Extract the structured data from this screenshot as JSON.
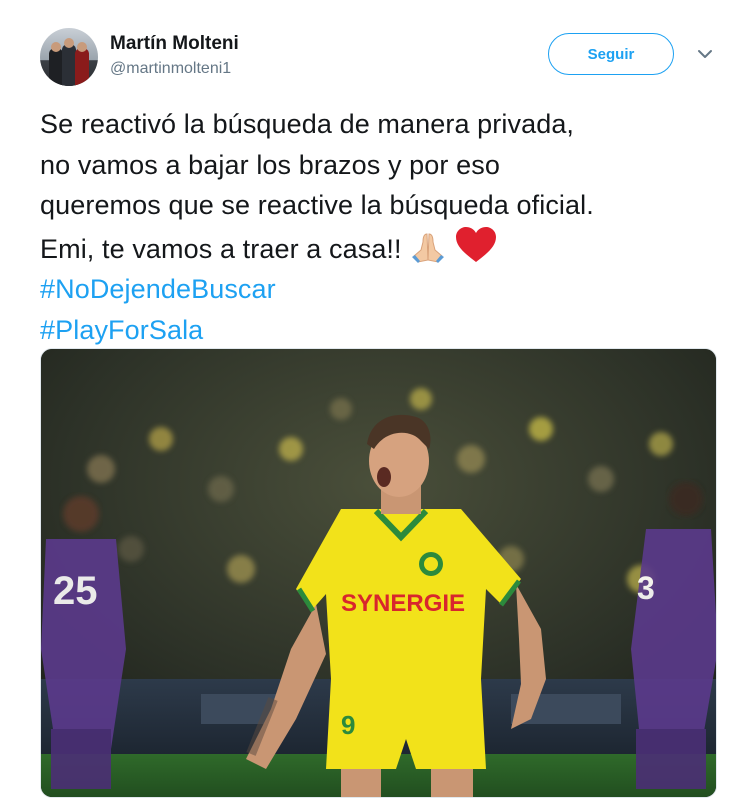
{
  "user": {
    "display_name": "Martín Molteni",
    "handle": "@martinmolteni1"
  },
  "follow_button": {
    "label": "Seguir"
  },
  "tweet": {
    "lines": [
      "Se reactivó la búsqueda de manera privada,",
      "no vamos a bajar los brazos y por eso",
      "queremos que se reactive la búsqueda oficial.",
      "Emi, te vamos a traer a casa!!"
    ],
    "hashtags": [
      "#NoDejendeBuscar",
      "#PlayForSala"
    ],
    "emojis": [
      "folded-hands",
      "red-heart"
    ]
  },
  "media": {
    "jersey_text": "SYNERGIE",
    "player_number": "9",
    "opponent_numbers": [
      "25",
      "3"
    ]
  },
  "colors": {
    "link": "#1da1f2",
    "text": "#14171a",
    "secondary": "#657786",
    "nantes_yellow": "#f2e21a",
    "toulouse_purple": "#5b3a8c"
  }
}
